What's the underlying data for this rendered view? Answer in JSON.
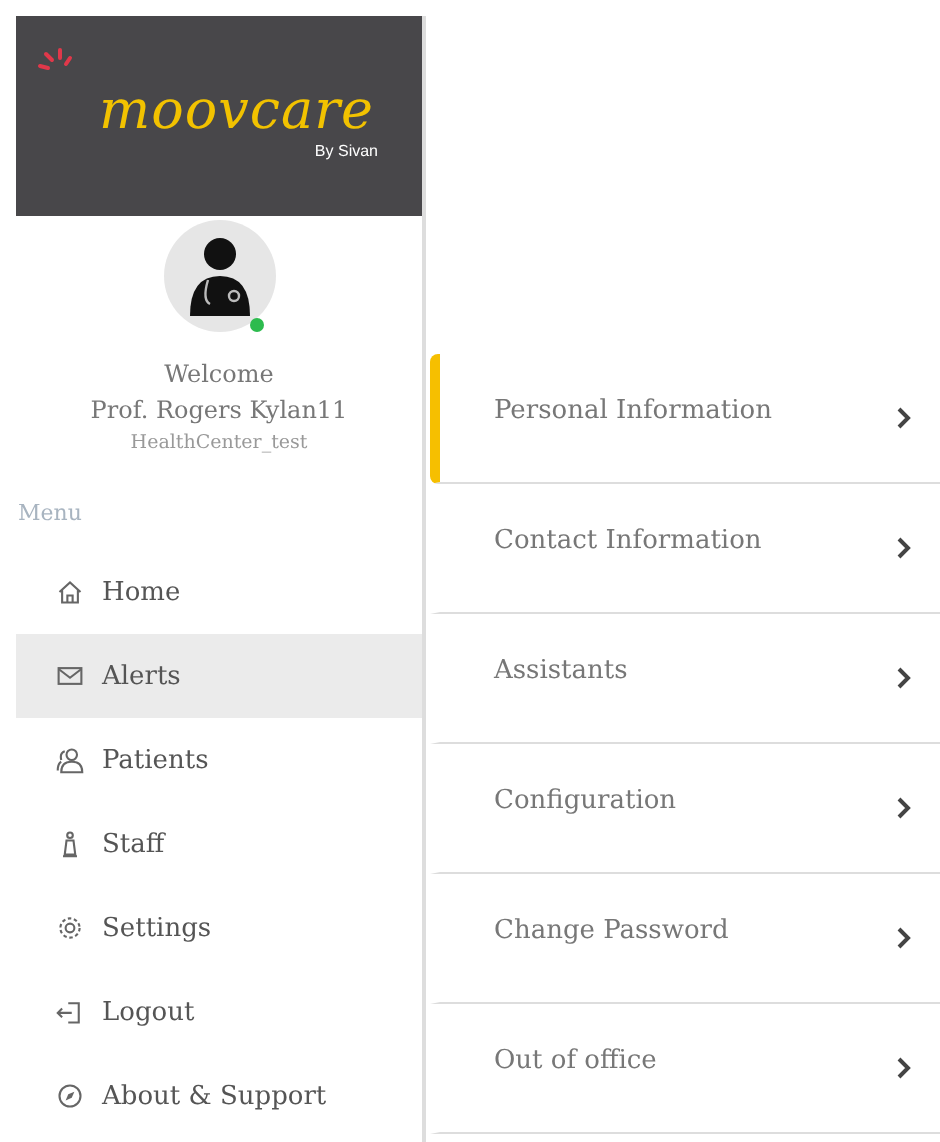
{
  "brand": {
    "logo": "moovcare",
    "tagline": "By Sivan"
  },
  "profile": {
    "online": true,
    "greeting": "Welcome",
    "name": "Prof. Rogers Kylan11",
    "center": "HealthCenter_test"
  },
  "menu": {
    "label": "Menu",
    "items": [
      {
        "label": "Home",
        "selected": false
      },
      {
        "label": "Alerts",
        "selected": true
      },
      {
        "label": "Patients",
        "selected": false
      },
      {
        "label": "Staff",
        "selected": false
      },
      {
        "label": "Settings",
        "selected": false
      },
      {
        "label": "Logout",
        "selected": false
      },
      {
        "label": "About & Support",
        "selected": false
      }
    ]
  },
  "settings_list": [
    {
      "label": "Personal Information",
      "selected": true
    },
    {
      "label": "Contact Information",
      "selected": false
    },
    {
      "label": "Assistants",
      "selected": false
    },
    {
      "label": "Configuration",
      "selected": false
    },
    {
      "label": "Change Password",
      "selected": false
    },
    {
      "label": "Out of office",
      "selected": false
    }
  ]
}
